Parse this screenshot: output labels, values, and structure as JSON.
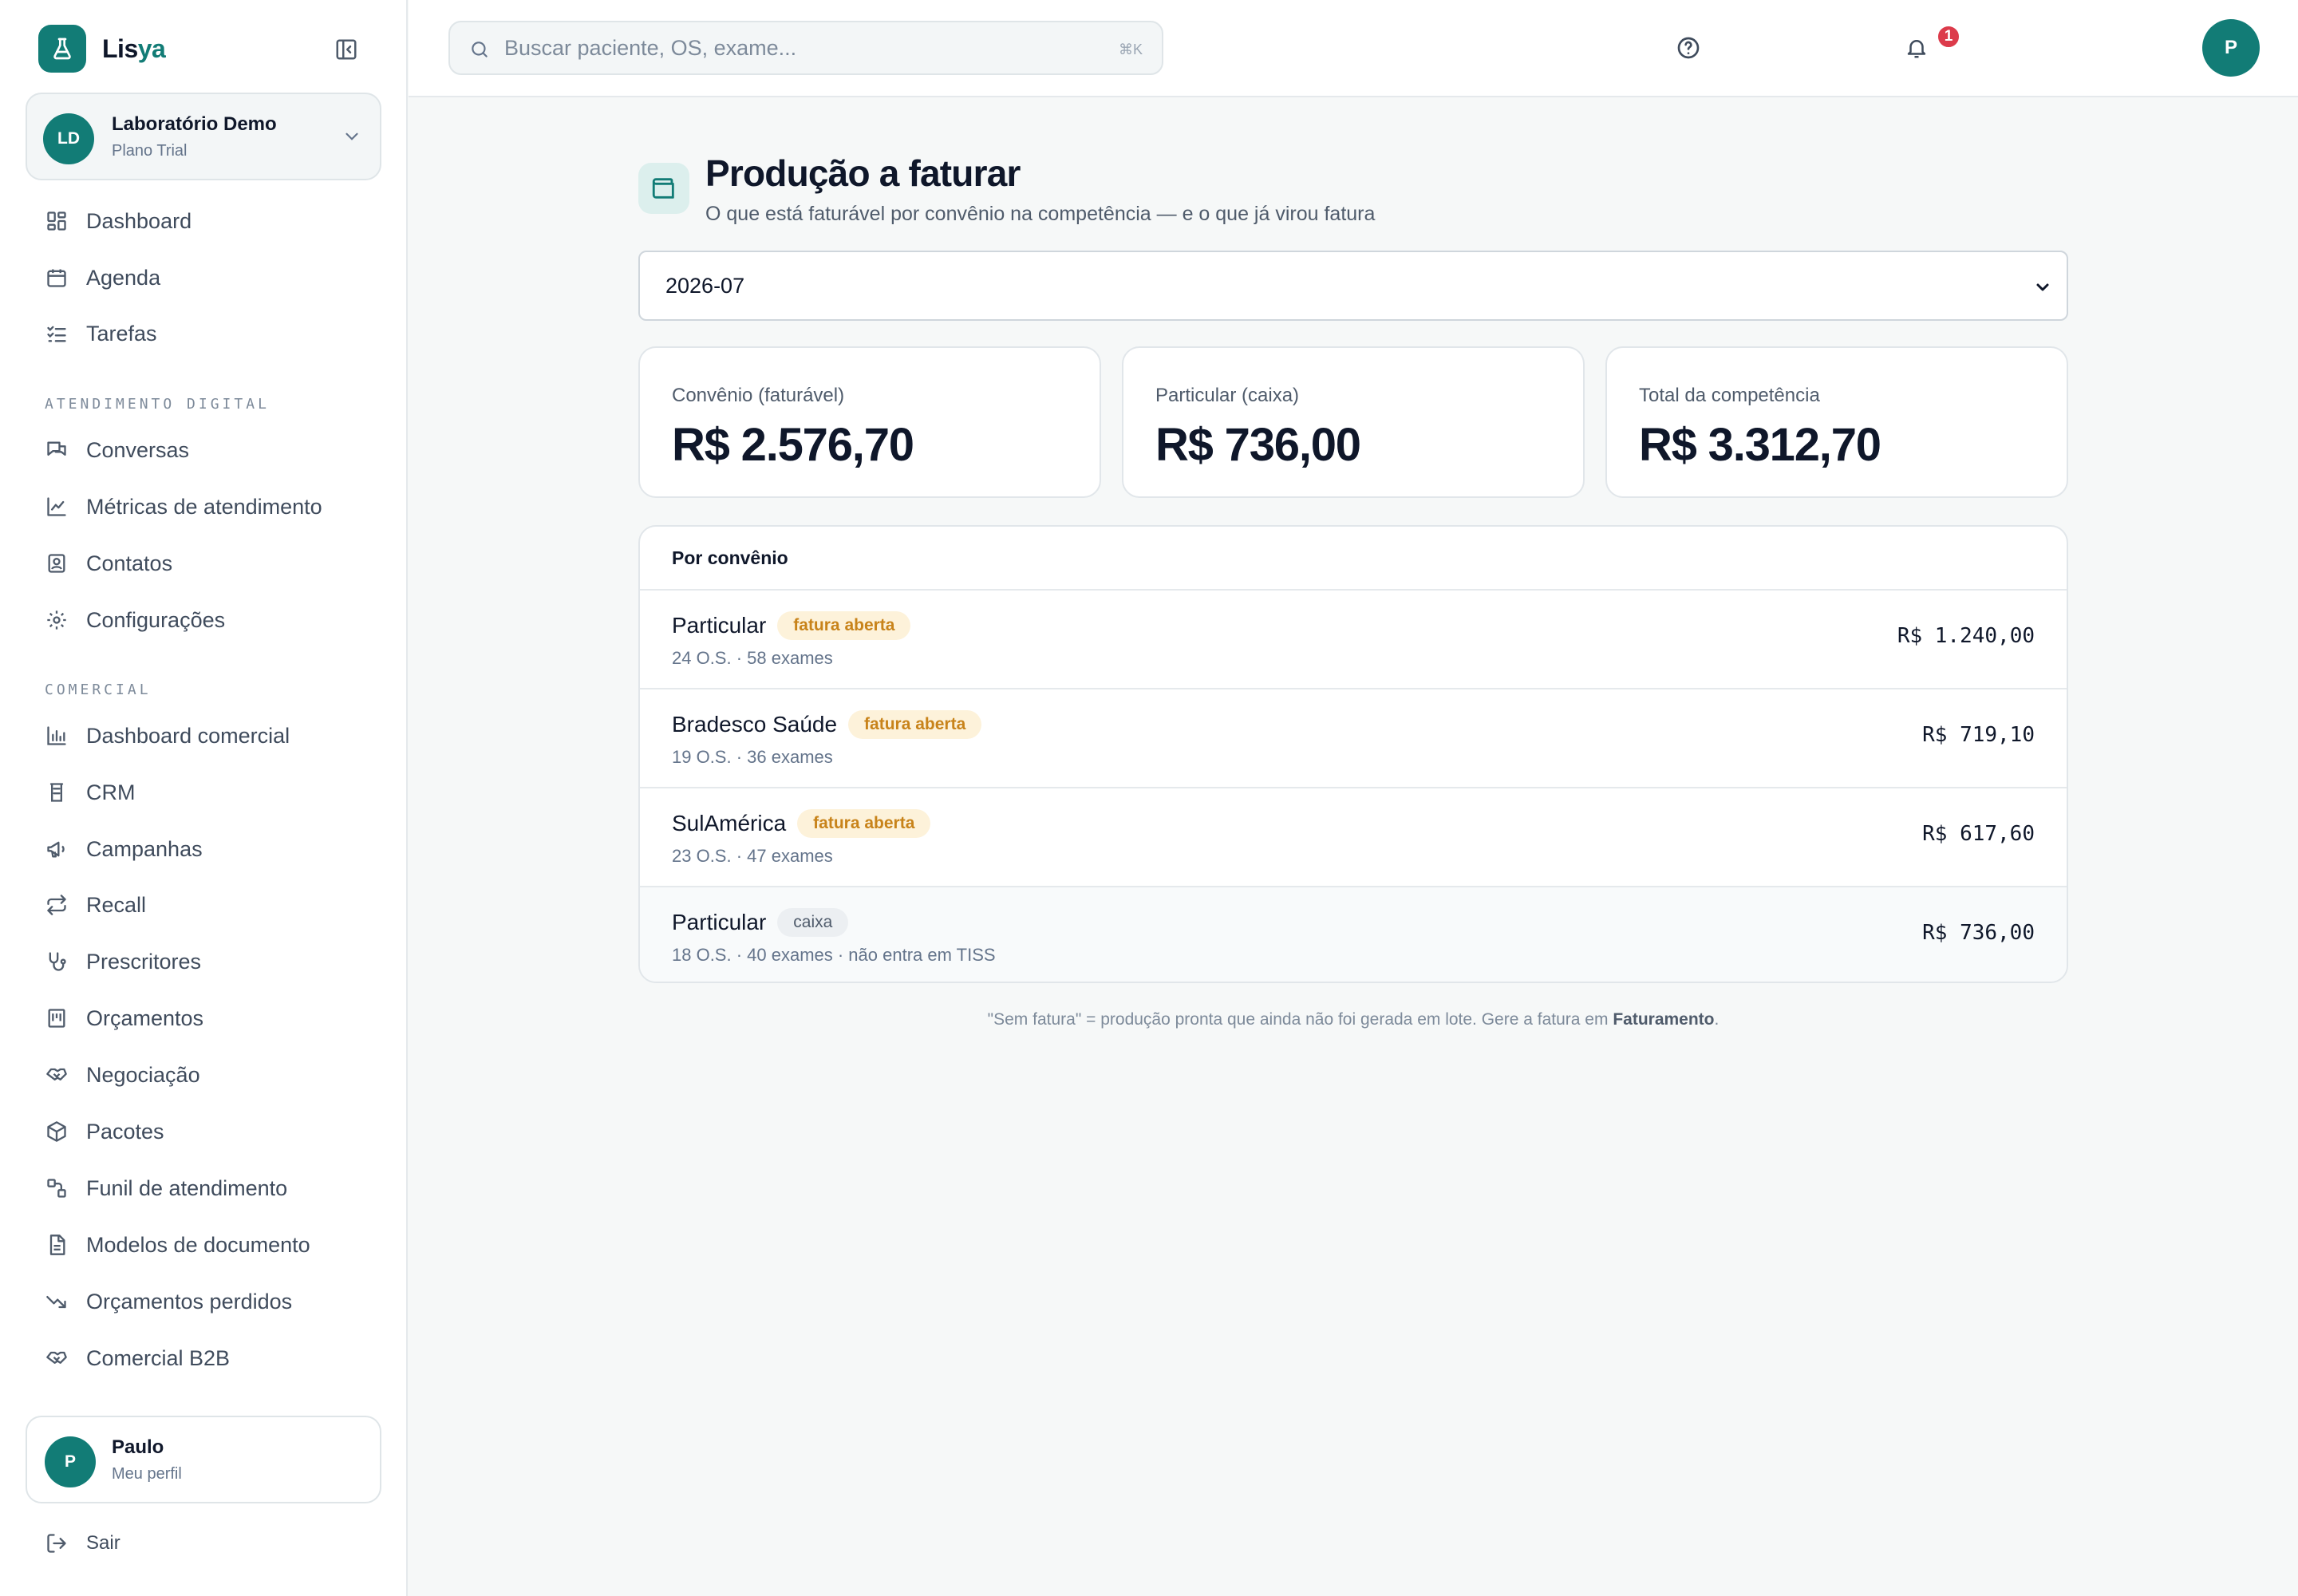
{
  "app": {
    "logo_part1": "Lis",
    "logo_part2": "ya",
    "brand_color": "#127c76"
  },
  "org": {
    "initials": "LD",
    "name": "Laboratório Demo",
    "plan": "Plano Trial"
  },
  "sidebar": {
    "main_items": [
      {
        "label": "Dashboard",
        "icon": "dashboard-icon"
      },
      {
        "label": "Agenda",
        "icon": "calendar-icon"
      },
      {
        "label": "Tarefas",
        "icon": "task-list-icon"
      }
    ],
    "section_atendimento": "ATENDIMENTO DIGITAL",
    "atendimento_items": [
      {
        "label": "Conversas",
        "icon": "chat-icon"
      },
      {
        "label": "Métricas de atendimento",
        "icon": "line-chart-icon"
      },
      {
        "label": "Contatos",
        "icon": "contact-icon"
      },
      {
        "label": "Configurações",
        "icon": "gear-icon"
      }
    ],
    "section_comercial": "COMERCIAL",
    "comercial_items": [
      {
        "label": "Dashboard comercial",
        "icon": "bar-chart-icon"
      },
      {
        "label": "CRM",
        "icon": "crm-icon"
      },
      {
        "label": "Campanhas",
        "icon": "megaphone-icon"
      },
      {
        "label": "Recall",
        "icon": "repeat-icon"
      },
      {
        "label": "Prescritores",
        "icon": "stethoscope-icon"
      },
      {
        "label": "Orçamentos",
        "icon": "budget-icon"
      },
      {
        "label": "Negociação",
        "icon": "handshake-icon"
      },
      {
        "label": "Pacotes",
        "icon": "package-icon"
      },
      {
        "label": "Funil de atendimento",
        "icon": "funnel-icon"
      },
      {
        "label": "Modelos de documento",
        "icon": "document-icon"
      },
      {
        "label": "Orçamentos perdidos",
        "icon": "trending-down-icon"
      },
      {
        "label": "Comercial B2B",
        "icon": "handshake-icon"
      }
    ]
  },
  "profile": {
    "initial": "P",
    "name": "Paulo",
    "sub": "Meu perfil"
  },
  "logout_label": "Sair",
  "topbar": {
    "search_placeholder": "Buscar paciente, OS, exame...",
    "search_shortcut": "⌘K",
    "notification_count": "1",
    "avatar_initial": "P"
  },
  "page": {
    "title": "Produção a faturar",
    "subtitle": "O que está faturável por convênio na competência — e o que já virou fatura",
    "period": "2026-07"
  },
  "kpis": [
    {
      "label": "Convênio (faturável)",
      "value": "R$ 2.576,70"
    },
    {
      "label": "Particular (caixa)",
      "value": "R$ 736,00"
    },
    {
      "label": "Total da competência",
      "value": "R$ 3.312,70"
    }
  ],
  "table": {
    "heading": "Por convênio",
    "rows": [
      {
        "name": "Particular",
        "badge": "fatura aberta",
        "meta": "24 O.S. · 58 exames",
        "amount": "R$ 1.240,00"
      },
      {
        "name": "Bradesco Saúde",
        "badge": "fatura aberta",
        "meta": "19 O.S. · 36 exames",
        "amount": "R$ 719,10"
      },
      {
        "name": "SulAmérica",
        "badge": "fatura aberta",
        "meta": "23 O.S. · 47 exames",
        "amount": "R$ 617,60"
      },
      {
        "name": "Particular",
        "badge": "caixa",
        "meta": "18 O.S. · 40 exames · não entra em TISS",
        "amount": "R$ 736,00"
      }
    ]
  },
  "footnote": {
    "text": "\"Sem fatura\" = produção pronta que ainda não foi gerada em lote. Gere a fatura em ",
    "link": "Faturamento",
    "end": "."
  }
}
